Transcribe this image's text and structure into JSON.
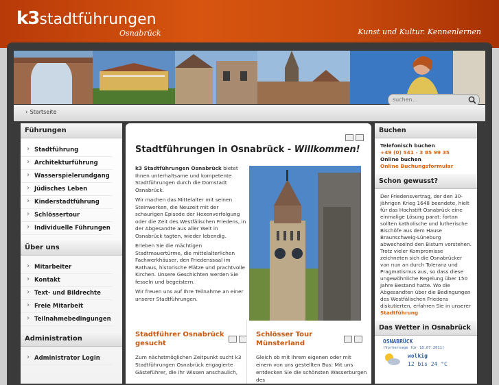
{
  "header": {
    "logo_k3": "k3",
    "logo_word": "stadtführungen",
    "logo_city": "Osnabrück",
    "slogan": "Kunst und Kultur. Kennenlernen"
  },
  "search": {
    "placeholder": "suchen..."
  },
  "breadcrumb": {
    "label": "Startseite"
  },
  "sidebar": {
    "sections": [
      {
        "title": "Führungen",
        "items": [
          "Stadtführung",
          "Architekturführung",
          "Wasserspielerundgang",
          "Jüdisches Leben",
          "Kinderstadtführung",
          "Schlössertour",
          "Individuelle Führungen"
        ]
      },
      {
        "title": "Über uns",
        "items": [
          "Mitarbeiter",
          "Kontakt",
          "Text- und Bildrechte",
          "Freie Mitarbeit",
          "Teilnahmebedingungen"
        ]
      },
      {
        "title": "Administration",
        "items": [
          "Administrator Login"
        ]
      }
    ]
  },
  "main": {
    "title": "Stadtführungen in Osnabrück - ",
    "title_em": "Willkommen!",
    "intro_bold": "k3 Stadtführungen Osnabrück",
    "intro_p1": " bietet Ihnen unterhaltsame und kompetente Stadtführungen durch die Domstadt Osnabrück.",
    "intro_p2": "Wir machen das Mittelalter mit seinen Steinwerken, die Neuzeit mit der schaurigen Episode der Hexenverfolgung oder die Zeit des Westfälischen Friedens, in der Abgesandte aus aller Welt in Osnabrück tagten, wieder lebendig.",
    "intro_p3": "Erleben Sie die mächtigen Stadtmauertürme, die mittelalterlichen Fachwerkhäuser, den Friedenssaal im Rathaus, historische Plätze und prachtvolle Kirchen. Unsere Geschichten werden Sie fesseln und begeistern.",
    "intro_p4": "Wir freuen uns auf Ihre Teilnahme an einer unserer Stadtführungen.",
    "teaser1_title": "Stadtführer Osnabrück gesucht",
    "teaser1_text": "Zum nächstmöglichen Zeitpunkt sucht k3 Stadtführungen Osnabrück engagierte Gästeführer, die ihr Wissen anschaulich,",
    "teaser2_title": "Schlösser Tour Münsterland",
    "teaser2_text": "Gleich ob mit Ihrem eigenen oder mit einem von uns gestellten Bus: Mit uns entdecken Sie die schönsten Wasserburgen des"
  },
  "right": {
    "buchen_title": "Buchen",
    "tel_label": "Telefonisch buchen",
    "tel_number": "+49 (0) 541 - 3 85 99 35",
    "online_label": "Online buchen",
    "online_link": "Online Buchungsformular",
    "fact_title": "Schon gewusst?",
    "fact_text": "Der Friedensvertrag, der den 30-jährigen Krieg 1648 beendete, hielt für das Hochstift Osnabrück eine einmalige Lösung parat: fortan sollten katholische und lutherische Bischöfe aus dem Hause Braunschweig-Lüneburg abwechselnd den Bistum vorstehen. Trotz vieler Kompromisse zeichneten sich die Osnabrücker von nun an durch Toleranz und Pragmatismus aus, so dass diese ungewöhnliche Regelung über 150 Jahre Bestand hatte. Wo die Abgesandten über die Bedingungen des Westfälischen Friedens diskutierten, erfahren Sie in unserer ",
    "fact_link": "Stadtführung",
    "weather_title": "Das Wetter in Osnabrück",
    "weather_city": "OSNABRÜCK",
    "weather_date": "(Vorhersage für 18.07.2011)",
    "weather_cond": "wolkig",
    "weather_temp": "12 bis 24 °C"
  },
  "colors": {
    "accent": "#c85a12",
    "header": "#c84a0c"
  }
}
